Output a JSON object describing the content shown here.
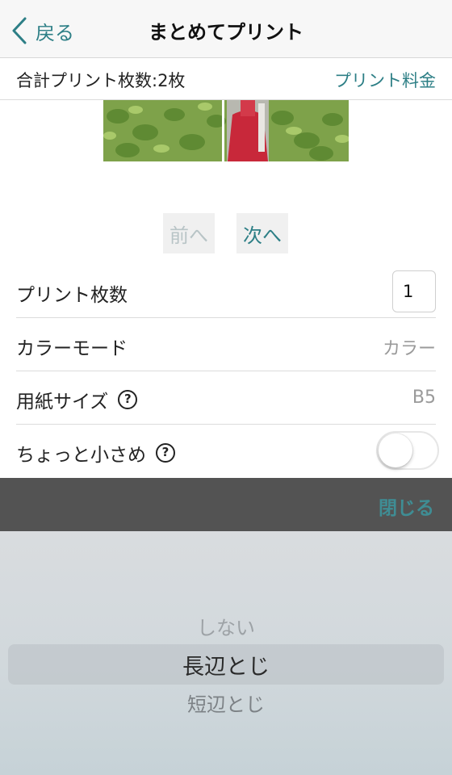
{
  "nav": {
    "back_label": "戻る",
    "title": "まとめてプリント"
  },
  "summary": {
    "total_label": "合計プリント枚数:2枚",
    "fee_label": "プリント料金"
  },
  "pager": {
    "prev_label": "前へ",
    "next_label": "次へ"
  },
  "settings": {
    "copies_label": "プリント枚数",
    "copies_value": "1",
    "color_mode_label": "カラーモード",
    "color_mode_value": "カラー",
    "paper_size_label": "用紙サイズ",
    "paper_size_value": "B5",
    "shrink_label": "ちょっと小さめ",
    "shrink_enabled": false,
    "help_glyph": "?"
  },
  "sheet": {
    "close_label": "閉じる",
    "options": [
      "しない",
      "長辺とじ",
      "短辺とじ"
    ],
    "selected": "長辺とじ"
  },
  "colors": {
    "accent": "#2d7f86",
    "sheet_bar": "#535353"
  }
}
